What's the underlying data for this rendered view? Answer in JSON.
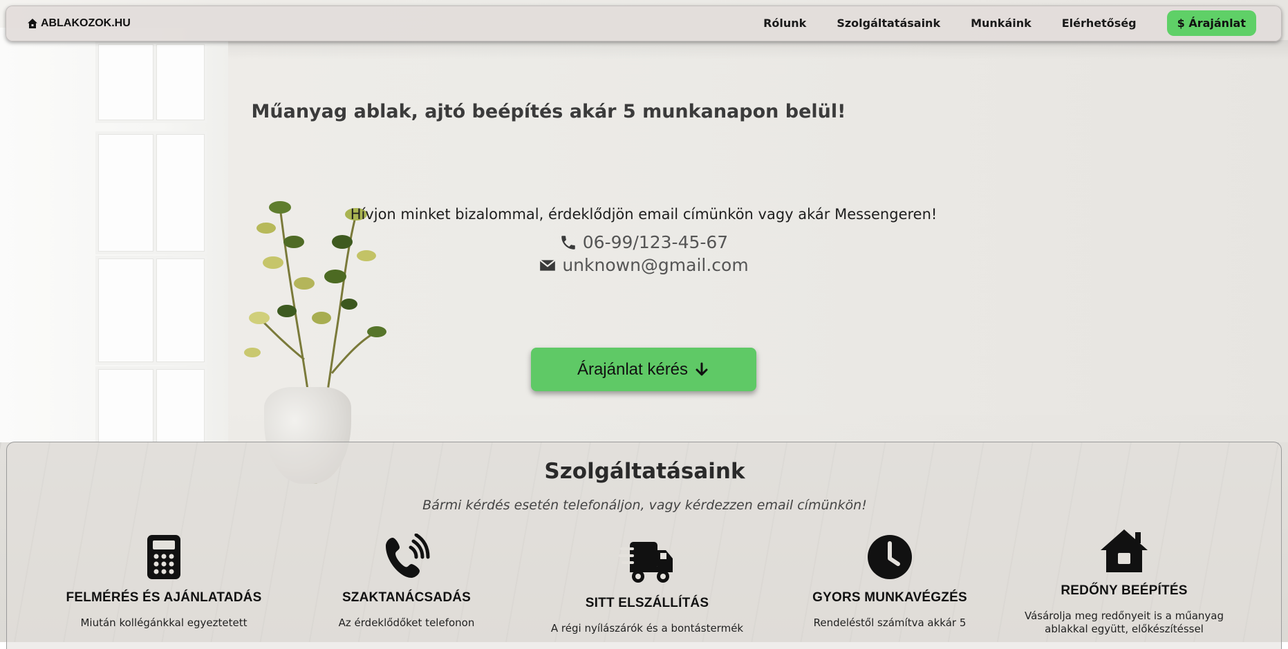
{
  "navbar": {
    "brand": "ABLAKOZOK.HU",
    "links": [
      "Rólunk",
      "Szolgáltatásaink",
      "Munkáink",
      "Elérhetőség"
    ],
    "cta": "$ Árajánlat"
  },
  "hero": {
    "title": "Műanyag ablak, ajtó beépítés akár 5 munkanapon belül!",
    "subtitle": "Hívjon minket bizalommal, érdeklődjön email címünkön vagy akár Messengeren!",
    "phone": "06-99/123-45-67",
    "email": "unknown@gmail.com",
    "button": "Árajánlat kérés"
  },
  "services": {
    "title": "Szolgáltatásaink",
    "subtitle": "Bármi kérdés esetén telefonáljon, vagy kérdezzen email címünkön!",
    "items": [
      {
        "icon": "calculator-icon",
        "title": "FELMÉRÉS ÉS AJÁNLATADÁS",
        "desc": "Miután kollégánkkal egyeztetett"
      },
      {
        "icon": "phone-volume-icon",
        "title": "SZAKTANÁCSADÁS",
        "desc": "Az érdeklődőket telefonon"
      },
      {
        "icon": "truck-fast-icon",
        "title": "SITT ELSZÁLLÍTÁS",
        "desc": "A régi nyílászárók és a bontástermék"
      },
      {
        "icon": "clock-icon",
        "title": "GYORS MUNKAVÉGZÉS",
        "desc": "Rendeléstől számítva akkár 5"
      },
      {
        "icon": "house-icon",
        "title": "REDŐNY BEÉPÍTÉS",
        "desc": "Vásárolja meg redőnyeit is a műanyag ablakkal együtt, előkészítéssel"
      }
    ]
  }
}
